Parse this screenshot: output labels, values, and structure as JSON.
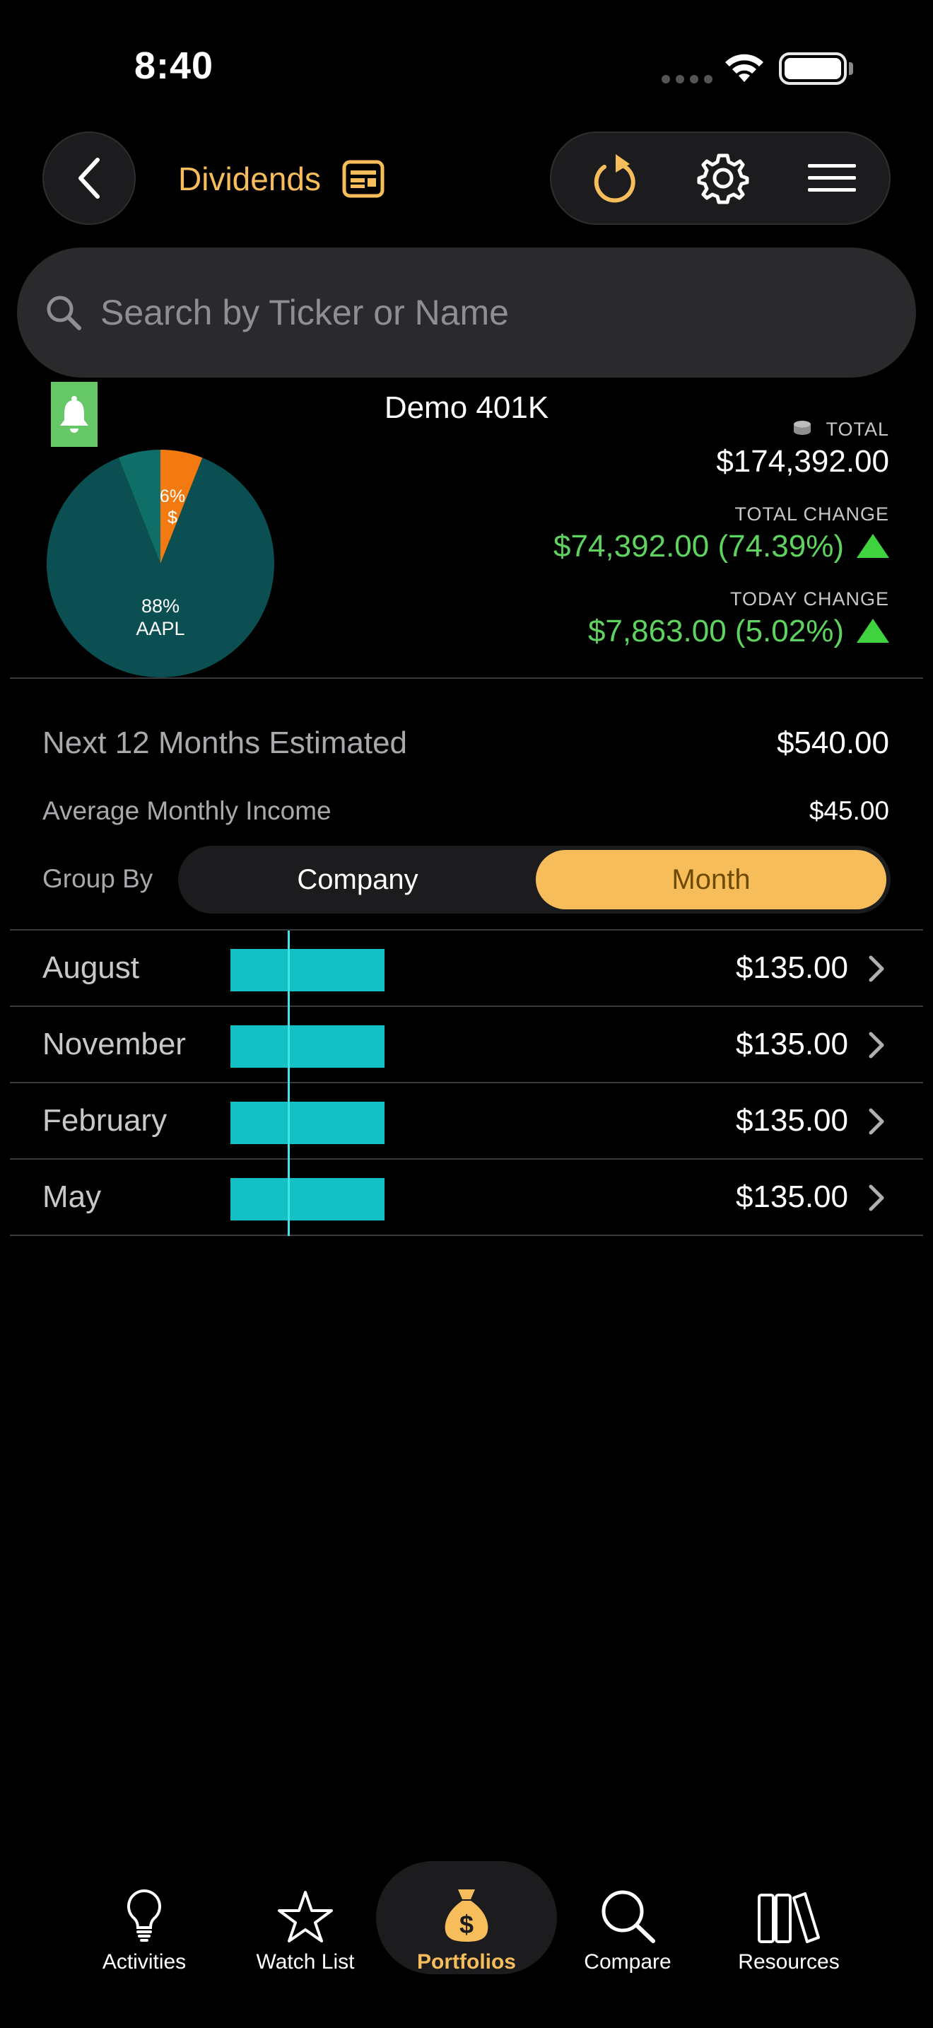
{
  "status_bar": {
    "time": "8:40"
  },
  "header": {
    "title": "Dividends"
  },
  "search": {
    "placeholder": "Search by Ticker or Name"
  },
  "portfolio": {
    "name": "Demo 401K",
    "total_label": "TOTAL",
    "total_value": "$174,392.00",
    "total_change_label": "TOTAL CHANGE",
    "total_change_value": "$74,392.00 (74.39%)",
    "today_change_label": "TODAY CHANGE",
    "today_change_value": "$7,863.00 (5.02%)",
    "pie": {
      "slices": [
        {
          "label": "AAPL",
          "percent_label": "88%",
          "fraction": 0.88,
          "color": "#0b4f52"
        },
        {
          "label": "$",
          "percent_label": "6%",
          "fraction": 0.06,
          "color": "#f37a10"
        },
        {
          "label": "",
          "percent_label": "",
          "fraction": 0.06,
          "color": "#0f6f68"
        }
      ]
    }
  },
  "stats": {
    "next12_label": "Next 12 Months Estimated",
    "next12_value": "$540.00",
    "avg_monthly_label": "Average Monthly Income",
    "avg_monthly_value": "$45.00",
    "group_by_label": "Group By",
    "group_options": [
      "Company",
      "Month"
    ],
    "group_selected": "Month"
  },
  "months": [
    {
      "name": "August",
      "amount": "$135.00"
    },
    {
      "name": "November",
      "amount": "$135.00"
    },
    {
      "name": "February",
      "amount": "$135.00"
    },
    {
      "name": "May",
      "amount": "$135.00"
    }
  ],
  "tabs": [
    {
      "label": "Activities",
      "icon": "lightbulb-icon"
    },
    {
      "label": "Watch List",
      "icon": "star-icon"
    },
    {
      "label": "Portfolios",
      "icon": "money-bag-icon",
      "active": true
    },
    {
      "label": "Compare",
      "icon": "magnifier-icon"
    },
    {
      "label": "Resources",
      "icon": "books-icon"
    }
  ],
  "colors": {
    "accent": "#f6bd5a",
    "positive": "#5fd35f",
    "bar": "#13c0c3",
    "background": "#000000"
  }
}
